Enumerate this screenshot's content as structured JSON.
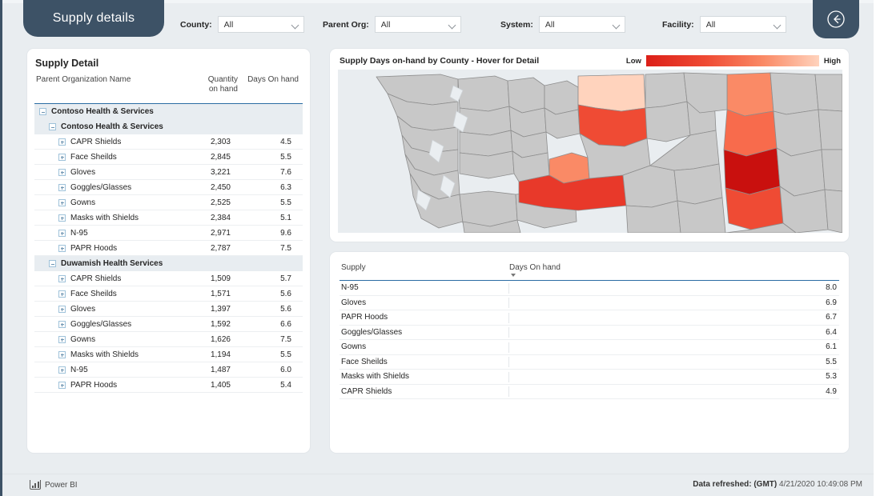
{
  "header": {
    "title": "Supply details",
    "back_icon": "back-arrow-circle-icon",
    "filters": [
      {
        "label": "County:",
        "value": "All"
      },
      {
        "label": "Parent Org:",
        "value": "All"
      },
      {
        "label": "System:",
        "value": "All"
      },
      {
        "label": "Facility:",
        "value": "All"
      }
    ]
  },
  "supply_detail": {
    "panel_title": "Supply Detail",
    "columns": {
      "name": "Parent Organization Name",
      "quantity": "Quantity on hand",
      "quantity_line1": "Quantity",
      "quantity_line2": "on hand",
      "days": "Days On hand"
    },
    "groups": [
      {
        "label": "Contoso Health & Services",
        "subgroups": [
          {
            "label": "Contoso Health & Services",
            "rows": [
              {
                "name": "CAPR Shields",
                "quantity": "2,303",
                "days": "4.5"
              },
              {
                "name": "Face Sheilds",
                "quantity": "2,845",
                "days": "5.5"
              },
              {
                "name": "Gloves",
                "quantity": "3,221",
                "days": "7.6"
              },
              {
                "name": "Goggles/Glasses",
                "quantity": "2,450",
                "days": "6.3"
              },
              {
                "name": "Gowns",
                "quantity": "2,525",
                "days": "5.5"
              },
              {
                "name": "Masks with Shields",
                "quantity": "2,384",
                "days": "5.1"
              },
              {
                "name": "N-95",
                "quantity": "2,971",
                "days": "9.6"
              },
              {
                "name": "PAPR Hoods",
                "quantity": "2,787",
                "days": "7.5"
              }
            ]
          },
          {
            "label": "Duwamish Health Services",
            "rows": [
              {
                "name": "CAPR Shields",
                "quantity": "1,509",
                "days": "5.7"
              },
              {
                "name": "Face Sheilds",
                "quantity": "1,571",
                "days": "5.6"
              },
              {
                "name": "Gloves",
                "quantity": "1,397",
                "days": "5.6"
              },
              {
                "name": "Goggles/Glasses",
                "quantity": "1,592",
                "days": "6.6"
              },
              {
                "name": "Gowns",
                "quantity": "1,626",
                "days": "7.5"
              },
              {
                "name": "Masks with Shields",
                "quantity": "1,194",
                "days": "5.5"
              },
              {
                "name": "N-95",
                "quantity": "1,487",
                "days": "6.0"
              },
              {
                "name": "PAPR Hoods",
                "quantity": "1,405",
                "days": "5.4"
              }
            ]
          }
        ]
      }
    ]
  },
  "map": {
    "title": "Supply Days on-hand by County - Hover for Detail",
    "legend_low": "Low",
    "legend_high": "High",
    "legend_colors": [
      "#dc1f18",
      "#ef4b34",
      "#fa8a66",
      "#ffd3bd"
    ],
    "default_county_color": "#c8c8c8",
    "highlighted_counties": [
      {
        "name": "Okanogan",
        "color": "#ffd3bd"
      },
      {
        "name": "Chelan",
        "color": "#ef4b34"
      },
      {
        "name": "Kittitas",
        "color": "#fa8a66"
      },
      {
        "name": "Yakima",
        "color": "#e8392a"
      },
      {
        "name": "Stevens",
        "color": "#fa8a66"
      },
      {
        "name": "Lincoln",
        "color": "#f86b4c"
      },
      {
        "name": "Spokane",
        "color": "#c9100e"
      },
      {
        "name": "Adams",
        "color": "#ef4b34"
      }
    ]
  },
  "chart_data": {
    "type": "bar",
    "title": "",
    "columns": {
      "category": "Supply",
      "value": "Days On hand"
    },
    "categories": [
      "N-95",
      "Gloves",
      "PAPR Hoods",
      "Goggles/Glasses",
      "Gowns",
      "Face Sheilds",
      "Masks with Shields",
      "CAPR Shields"
    ],
    "values": [
      8.0,
      6.9,
      6.7,
      6.4,
      6.1,
      5.5,
      5.3,
      4.9
    ],
    "value_labels": [
      "8.0",
      "6.9",
      "6.7",
      "6.4",
      "6.1",
      "5.5",
      "5.3",
      "4.9"
    ],
    "xlabel": "Days On hand",
    "ylabel": "Supply",
    "xlim": [
      0,
      8.0
    ],
    "sorted_by": "Days On hand",
    "sort_direction": "descending",
    "bar_color": "#a5cfe3",
    "grid": false,
    "legend": false
  },
  "footer": {
    "powerbi_label": "Power BI",
    "refresh_label": "Data refreshed: (GMT)",
    "refresh_value": "4/21/2020 10:49:08 PM"
  }
}
